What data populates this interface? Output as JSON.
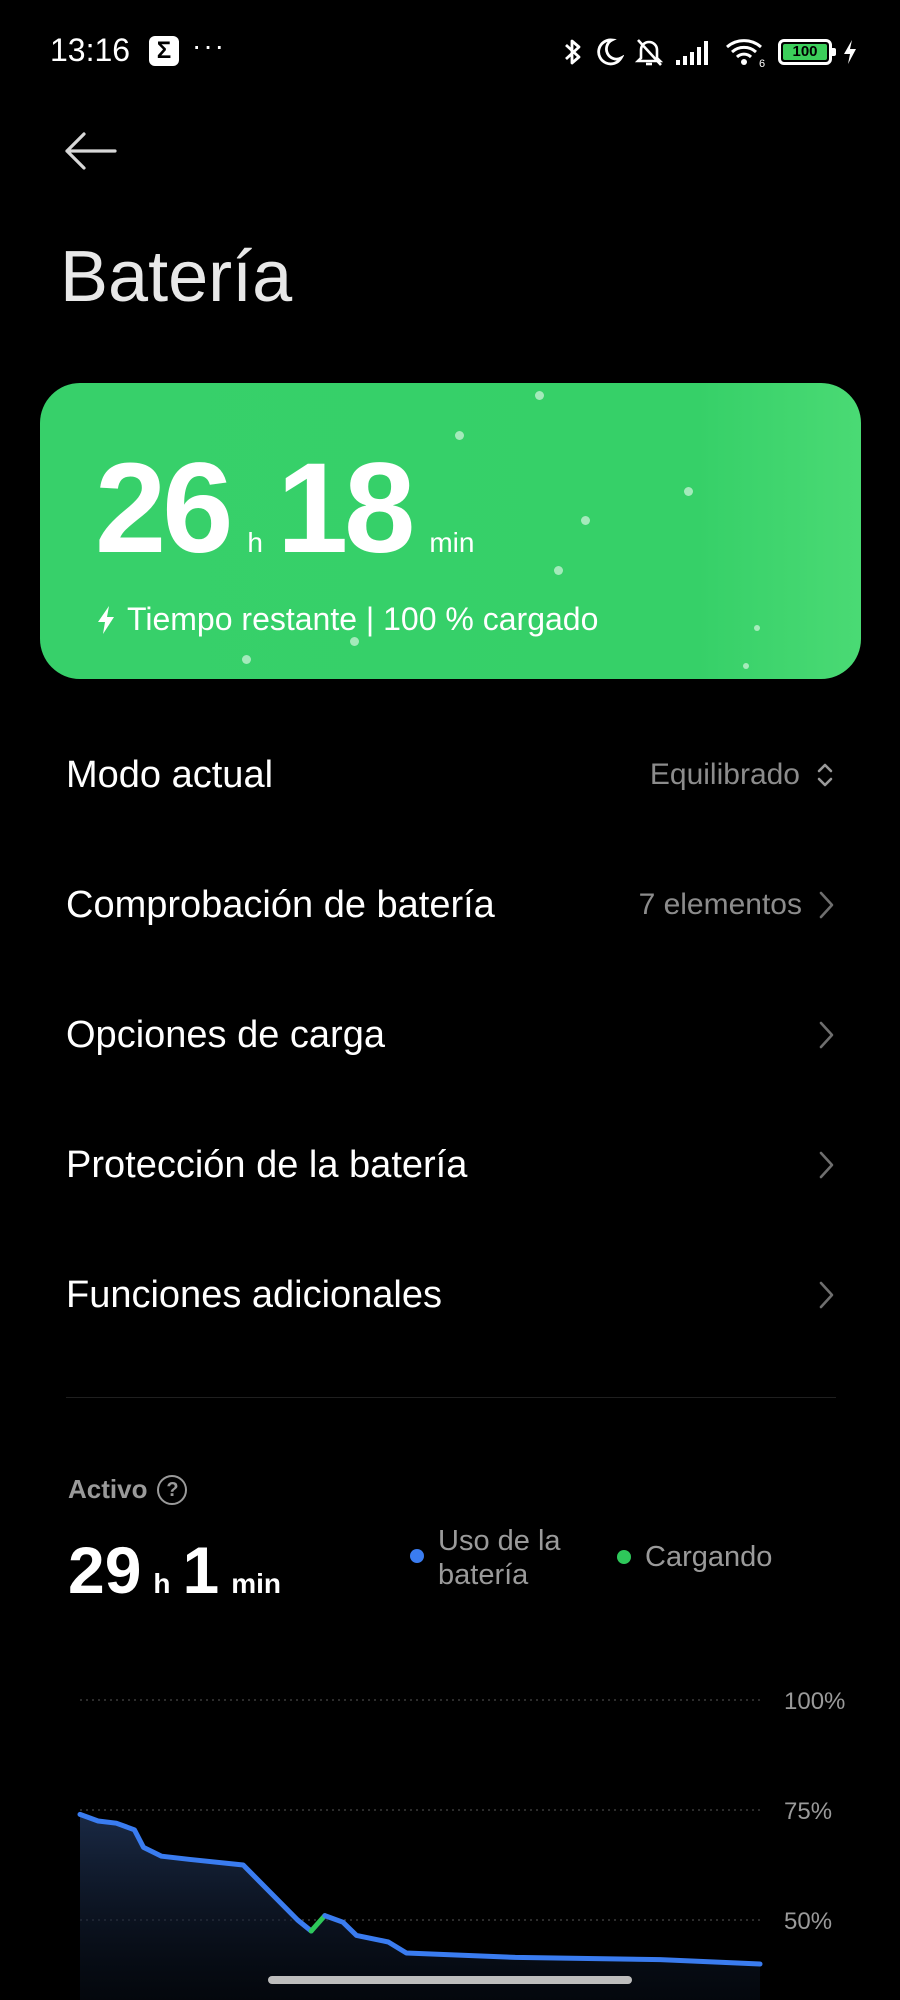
{
  "status_bar": {
    "time": "13:16",
    "notification_icon": "Σ",
    "more": "···",
    "icons": [
      "bluetooth-icon",
      "moon-icon",
      "bell-off-icon",
      "signal-icon",
      "wifi-icon"
    ],
    "wifi_label": "6",
    "battery_level": "100",
    "charging": true
  },
  "page": {
    "title": "Batería"
  },
  "hero": {
    "hours": "26",
    "hours_unit": "h",
    "minutes": "18",
    "minutes_unit": "min",
    "subtitle": "Tiempo restante | 100 % cargado",
    "color": "#37d06a"
  },
  "menu": {
    "items": [
      {
        "label": "Modo actual",
        "value": "Equilibrado",
        "icon": "up-down-chevron-icon"
      },
      {
        "label": "Comprobación de batería",
        "value": "7 elementos",
        "icon": "chevron-right-icon"
      },
      {
        "label": "Opciones de carga",
        "value": "",
        "icon": "chevron-right-icon"
      },
      {
        "label": "Protección de la batería",
        "value": "",
        "icon": "chevron-right-icon"
      },
      {
        "label": "Funciones adicionales",
        "value": "",
        "icon": "chevron-right-icon"
      }
    ]
  },
  "usage": {
    "label": "Activo",
    "hours": "29",
    "hours_unit": "h",
    "minutes": "1",
    "minutes_unit": "min",
    "legend": [
      {
        "name": "Uso de la batería",
        "name_line1": "Uso de la",
        "name_line2": "batería",
        "color": "#3a7cf0"
      },
      {
        "name": "Cargando",
        "color": "#2ec85a"
      }
    ]
  },
  "chart_data": {
    "type": "area",
    "y_ticks": [
      "100%",
      "75%",
      "50%"
    ],
    "ylim": [
      25,
      100
    ],
    "series": [
      {
        "name": "Uso de la batería",
        "color": "#3a7cf0",
        "x": [
          0,
          2,
          4,
          6,
          7,
          9,
          12,
          18,
          24,
          25.5
        ],
        "y": [
          74,
          72.5,
          72,
          70.5,
          66.5,
          64.5,
          63.8,
          62.5,
          50,
          47.5
        ]
      },
      {
        "name": "Cargando",
        "color": "#2ec85a",
        "x": [
          25.5,
          27
        ],
        "y": [
          47.5,
          51
        ]
      },
      {
        "name": "Uso de la batería",
        "color": "#3a7cf0",
        "x": [
          27,
          29,
          30.5,
          34,
          36,
          48,
          64,
          75
        ],
        "y": [
          51,
          49.5,
          46.5,
          45,
          42.5,
          41.5,
          41,
          40
        ]
      }
    ]
  }
}
